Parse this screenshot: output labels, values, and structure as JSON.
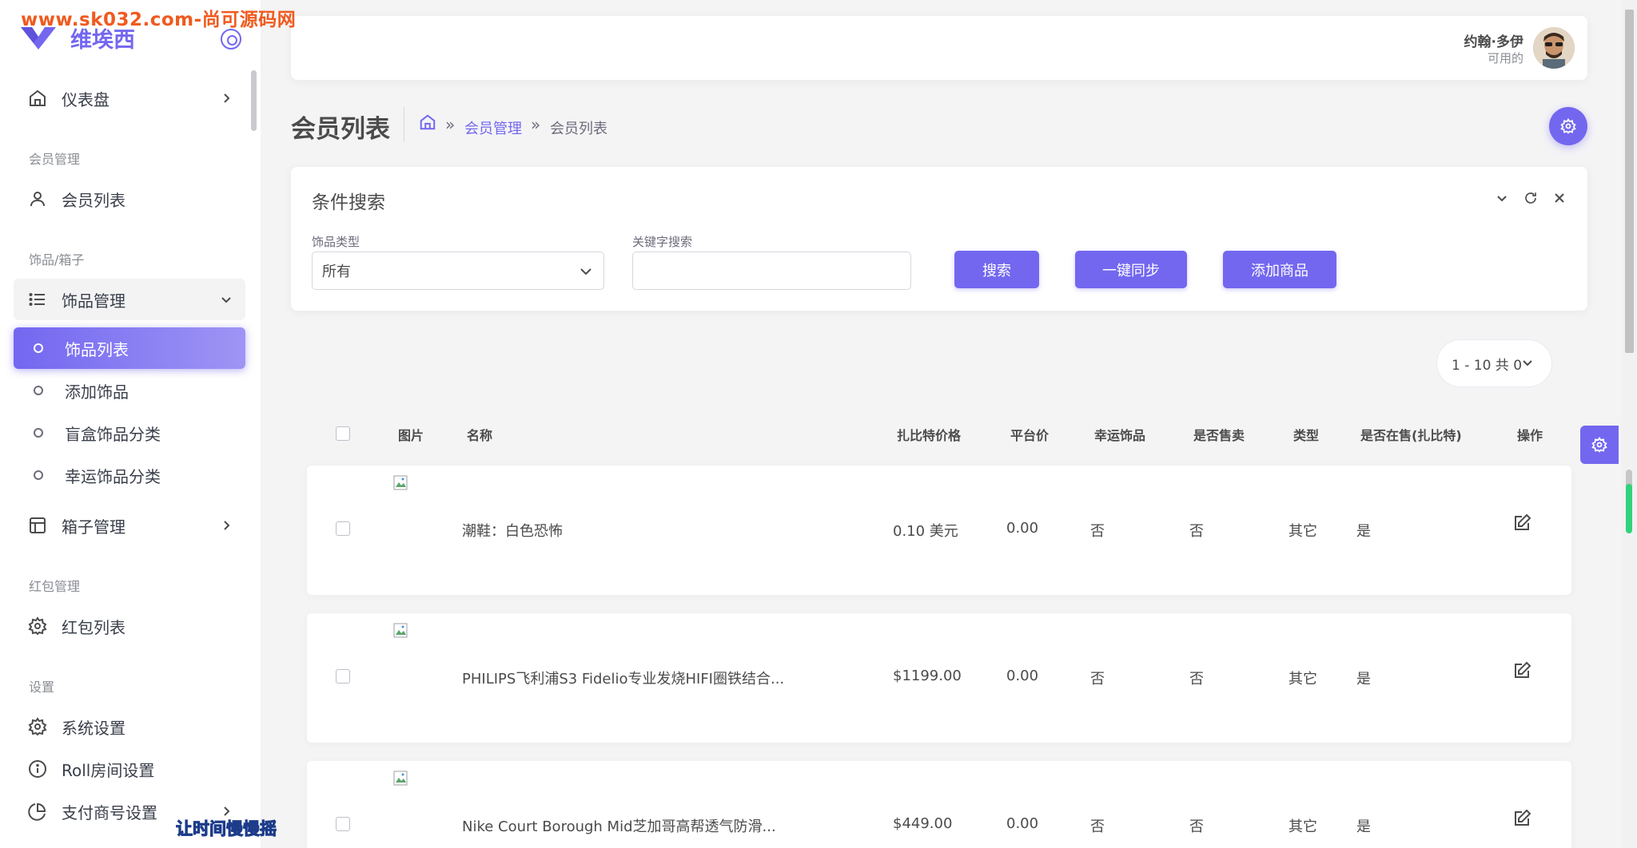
{
  "watermark": {
    "top": "www.sk032.com-尚可源码网",
    "bottom": "让时间慢慢摇"
  },
  "brand": {
    "name": "维埃西"
  },
  "sidebar": {
    "dashboard": "仪表盘",
    "sections": [
      "会员管理",
      "饰品/箱子",
      "红包管理",
      "设置"
    ],
    "member_list": "会员列表",
    "jewelry_manage": "饰品管理",
    "jewelry_sub": [
      "饰品列表",
      "添加饰品",
      "盲盒饰品分类",
      "幸运饰品分类"
    ],
    "box_manage": "箱子管理",
    "redpack_list": "红包列表",
    "system_settings": "系统设置",
    "roll_settings": "Roll房间设置",
    "pay_settings": "支付商号设置"
  },
  "user": {
    "name": "约翰·多伊",
    "status": "可用的"
  },
  "page": {
    "title": "会员列表",
    "breadcrumb": [
      "会员管理",
      "会员列表"
    ],
    "sep": "»"
  },
  "search": {
    "title": "条件搜索",
    "type_label": "饰品类型",
    "type_value": "所有",
    "kw_label": "关键字搜索",
    "kw_value": "",
    "btn_search": "搜索",
    "btn_sync": "一键同步",
    "btn_add": "添加商品"
  },
  "pager": {
    "text": "1 - 10 共 0"
  },
  "table": {
    "headers": [
      "图片",
      "名称",
      "扎比特价格",
      "平台价",
      "幸运饰品",
      "是否售卖",
      "类型",
      "是否在售(扎比特)",
      "操作"
    ],
    "rows": [
      {
        "name": "潮鞋：白色恐怖",
        "price": "0.10 美元",
        "platform": "0.00",
        "lucky": "否",
        "sale": "否",
        "type": "其它",
        "onsale": "是"
      },
      {
        "name": "PHILIPS飞利浦S3 Fidelio专业发烧HIFI圈铁结合...",
        "price": "$1199.00",
        "platform": "0.00",
        "lucky": "否",
        "sale": "否",
        "type": "其它",
        "onsale": "是"
      },
      {
        "name": "Nike Court Borough Mid芝加哥高帮透气防滑...",
        "price": "$449.00",
        "platform": "0.00",
        "lucky": "否",
        "sale": "否",
        "type": "其它",
        "onsale": "是"
      }
    ]
  },
  "colors": {
    "accent": "#7367f0",
    "text": "#4b4b4b",
    "muted": "#8a8d93",
    "bg": "#f4f4f5"
  },
  "icons": [
    "home-icon",
    "user-icon",
    "list-icon",
    "circle-icon",
    "layout-icon",
    "gear-icon",
    "info-icon",
    "pie-icon",
    "chevron-right-icon",
    "chevron-down-icon",
    "refresh-icon",
    "close-icon",
    "edit-icon",
    "broken-image-icon"
  ]
}
